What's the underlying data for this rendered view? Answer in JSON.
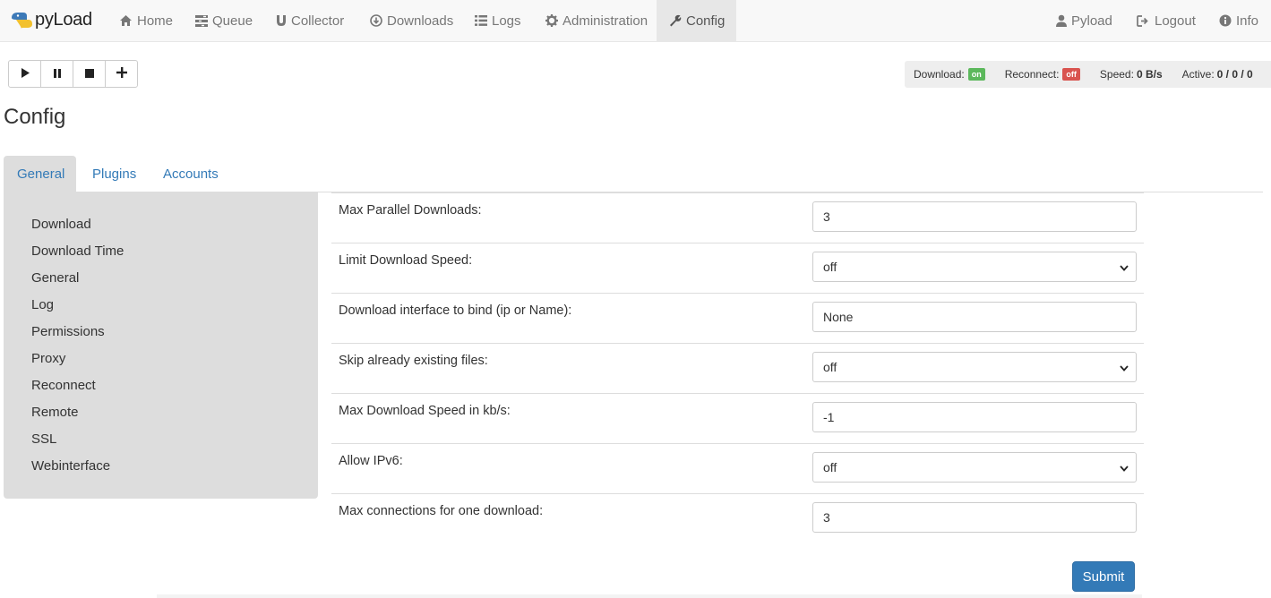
{
  "brand": {
    "name": "pyLoad"
  },
  "nav": {
    "home": "Home",
    "queue": "Queue",
    "collector": "Collector",
    "downloads": "Downloads",
    "logs": "Logs",
    "administration": "Administration",
    "config": "Config",
    "user": "Pyload",
    "logout": "Logout",
    "info": "Info"
  },
  "status": {
    "download_label": "Download:",
    "download_value": "on",
    "reconnect_label": "Reconnect:",
    "reconnect_value": "off",
    "speed_label": "Speed:",
    "speed_value": "0 B/s",
    "active_label": "Active:",
    "active_value": "0 / 0 / 0"
  },
  "page": {
    "title": "Config"
  },
  "tabs": [
    "General",
    "Plugins",
    "Accounts"
  ],
  "sidebar": [
    "Download",
    "Download Time",
    "General",
    "Log",
    "Permissions",
    "Proxy",
    "Reconnect",
    "Remote",
    "SSL",
    "Webinterface"
  ],
  "form": [
    {
      "label": "Max Parallel Downloads:",
      "value": "3",
      "type": "text"
    },
    {
      "label": "Limit Download Speed:",
      "value": "off",
      "type": "select"
    },
    {
      "label": "Download interface to bind (ip or Name):",
      "value": "None",
      "type": "text"
    },
    {
      "label": "Skip already existing files:",
      "value": "off",
      "type": "select"
    },
    {
      "label": "Max Download Speed in kb/s:",
      "value": "-1",
      "type": "text"
    },
    {
      "label": "Allow IPv6:",
      "value": "off",
      "type": "select"
    },
    {
      "label": "Max connections for one download:",
      "value": "3",
      "type": "text"
    }
  ],
  "submit_label": "Submit",
  "colors": {
    "primary": "#337ab7",
    "on": "#5cb85c",
    "off": "#d9534f",
    "sidebar": "#dddddd"
  }
}
